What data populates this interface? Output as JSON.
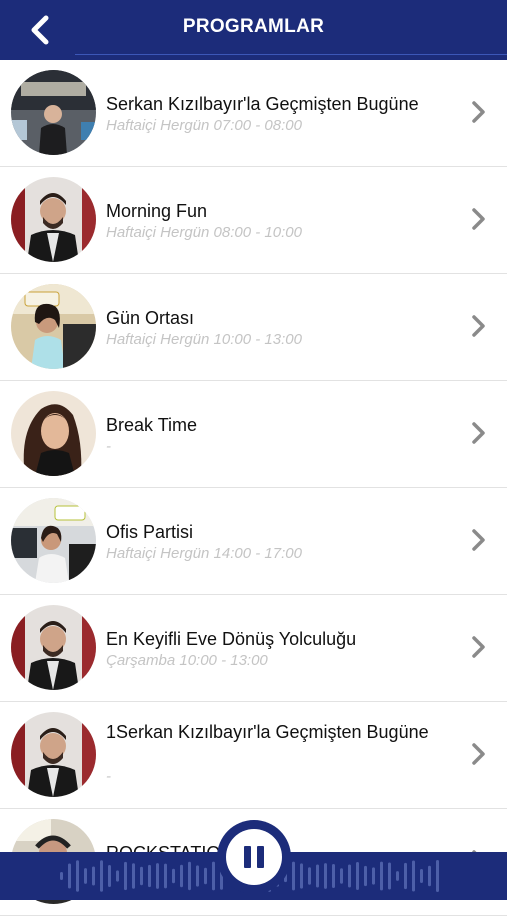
{
  "header": {
    "title": "PROGRAMLAR",
    "back_icon": "chevron-left-icon",
    "background": "#1c2c7a"
  },
  "programs": [
    {
      "title": "Serkan Kızılbayır'la Geçmişten Bugüne",
      "schedule": "Haftaiçi Hergün 07:00 - 08:00"
    },
    {
      "title": "Morning Fun",
      "schedule": "Haftaiçi Hergün 08:00 - 10:00"
    },
    {
      "title": "Gün Ortası",
      "schedule": "Haftaiçi Hergün 10:00 - 13:00"
    },
    {
      "title": "Break Time",
      "schedule": "-"
    },
    {
      "title": "Ofis Partisi",
      "schedule": "Haftaiçi Hergün 14:00 - 17:00"
    },
    {
      "title": "En Keyifli Eve Dönüş Yolculuğu",
      "schedule": "Çarşamba 10:00 - 13:00"
    },
    {
      "title": "1Serkan Kızılbayır'la Geçmişten Bugüne",
      "schedule": "-"
    },
    {
      "title": "ROCKSTATION",
      "schedule": ""
    }
  ],
  "player": {
    "state": "playing",
    "button_icon": "pause-icon",
    "waveform_icon": "audio-waveform-icon"
  },
  "colors": {
    "brand": "#1c2c7a",
    "subtitle": "#c4c4c4",
    "chevron": "#8a8a8a"
  }
}
